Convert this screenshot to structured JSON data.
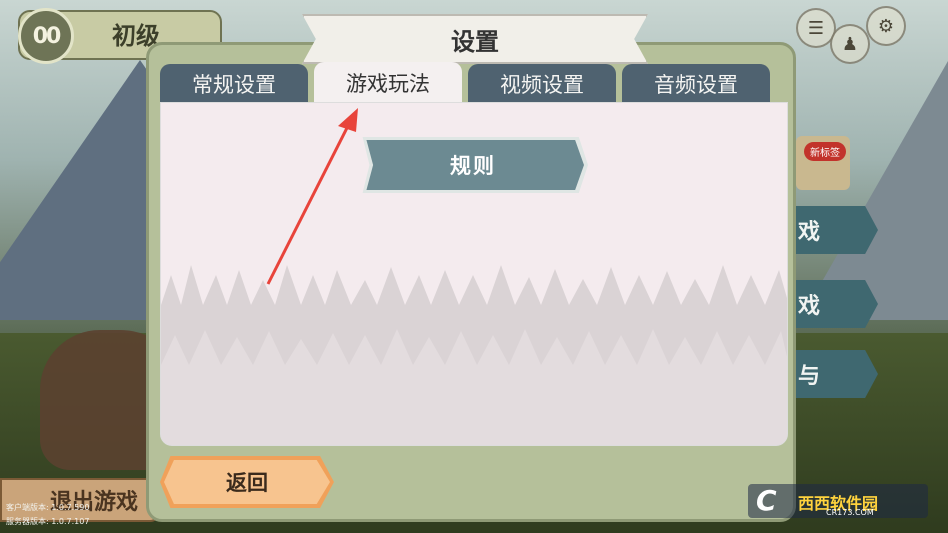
{
  "hud": {
    "pause_label": "00",
    "level_label": "初级"
  },
  "dialog": {
    "title": "设置",
    "tabs": [
      {
        "label": "常规设置",
        "active": false
      },
      {
        "label": "游戏玩法",
        "active": true
      },
      {
        "label": "视频设置",
        "active": false
      },
      {
        "label": "音频设置",
        "active": false
      }
    ],
    "rule_button": "规则",
    "back_button": "返回"
  },
  "side": {
    "new_badge": "新标签",
    "btn1": "戏",
    "btn2": "戏",
    "btn3": "与"
  },
  "exit_button": "退出游戏",
  "version": {
    "client": "客户端版本: 1.0.7.590",
    "server": "服务器版本: 1.0.7.107"
  },
  "watermark": {
    "logo": "C",
    "name": "西西软件园",
    "url": "CR173.COM"
  },
  "colors": {
    "tab_inactive": "#4f6270",
    "tab_active": "#f4f0f0",
    "rule_button": "#6c8a92",
    "back_button": "#f7c48f",
    "arrow": "#e8443b"
  }
}
